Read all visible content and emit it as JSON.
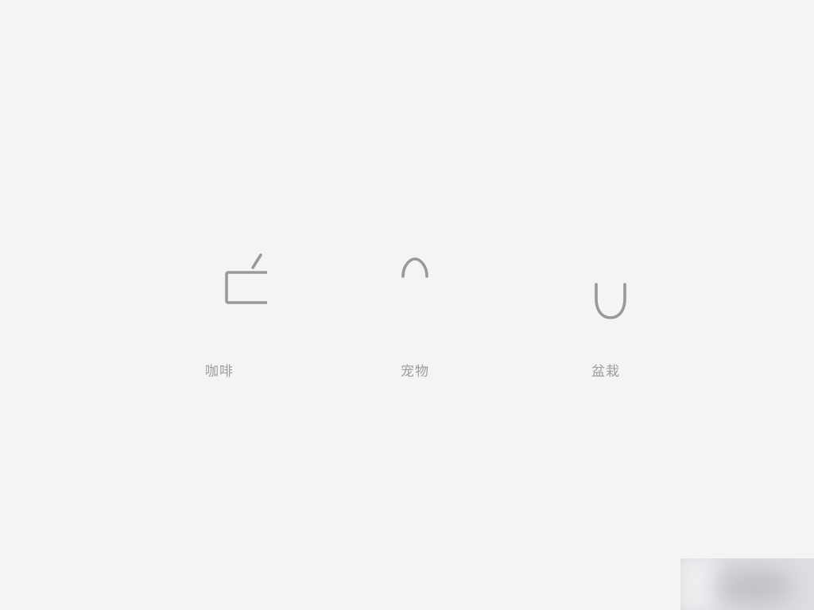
{
  "categories": [
    {
      "id": "coffee",
      "label": "咖啡",
      "icon": "coffee-cup-icon"
    },
    {
      "id": "pet",
      "label": "宠物",
      "icon": "dog-face-icon"
    },
    {
      "id": "plant",
      "label": "盆栽",
      "icon": "potted-plant-icon"
    }
  ],
  "colors": {
    "background": "#f4f4f4",
    "icon_stroke": "#999999",
    "label_text": "#9c9c9c"
  }
}
